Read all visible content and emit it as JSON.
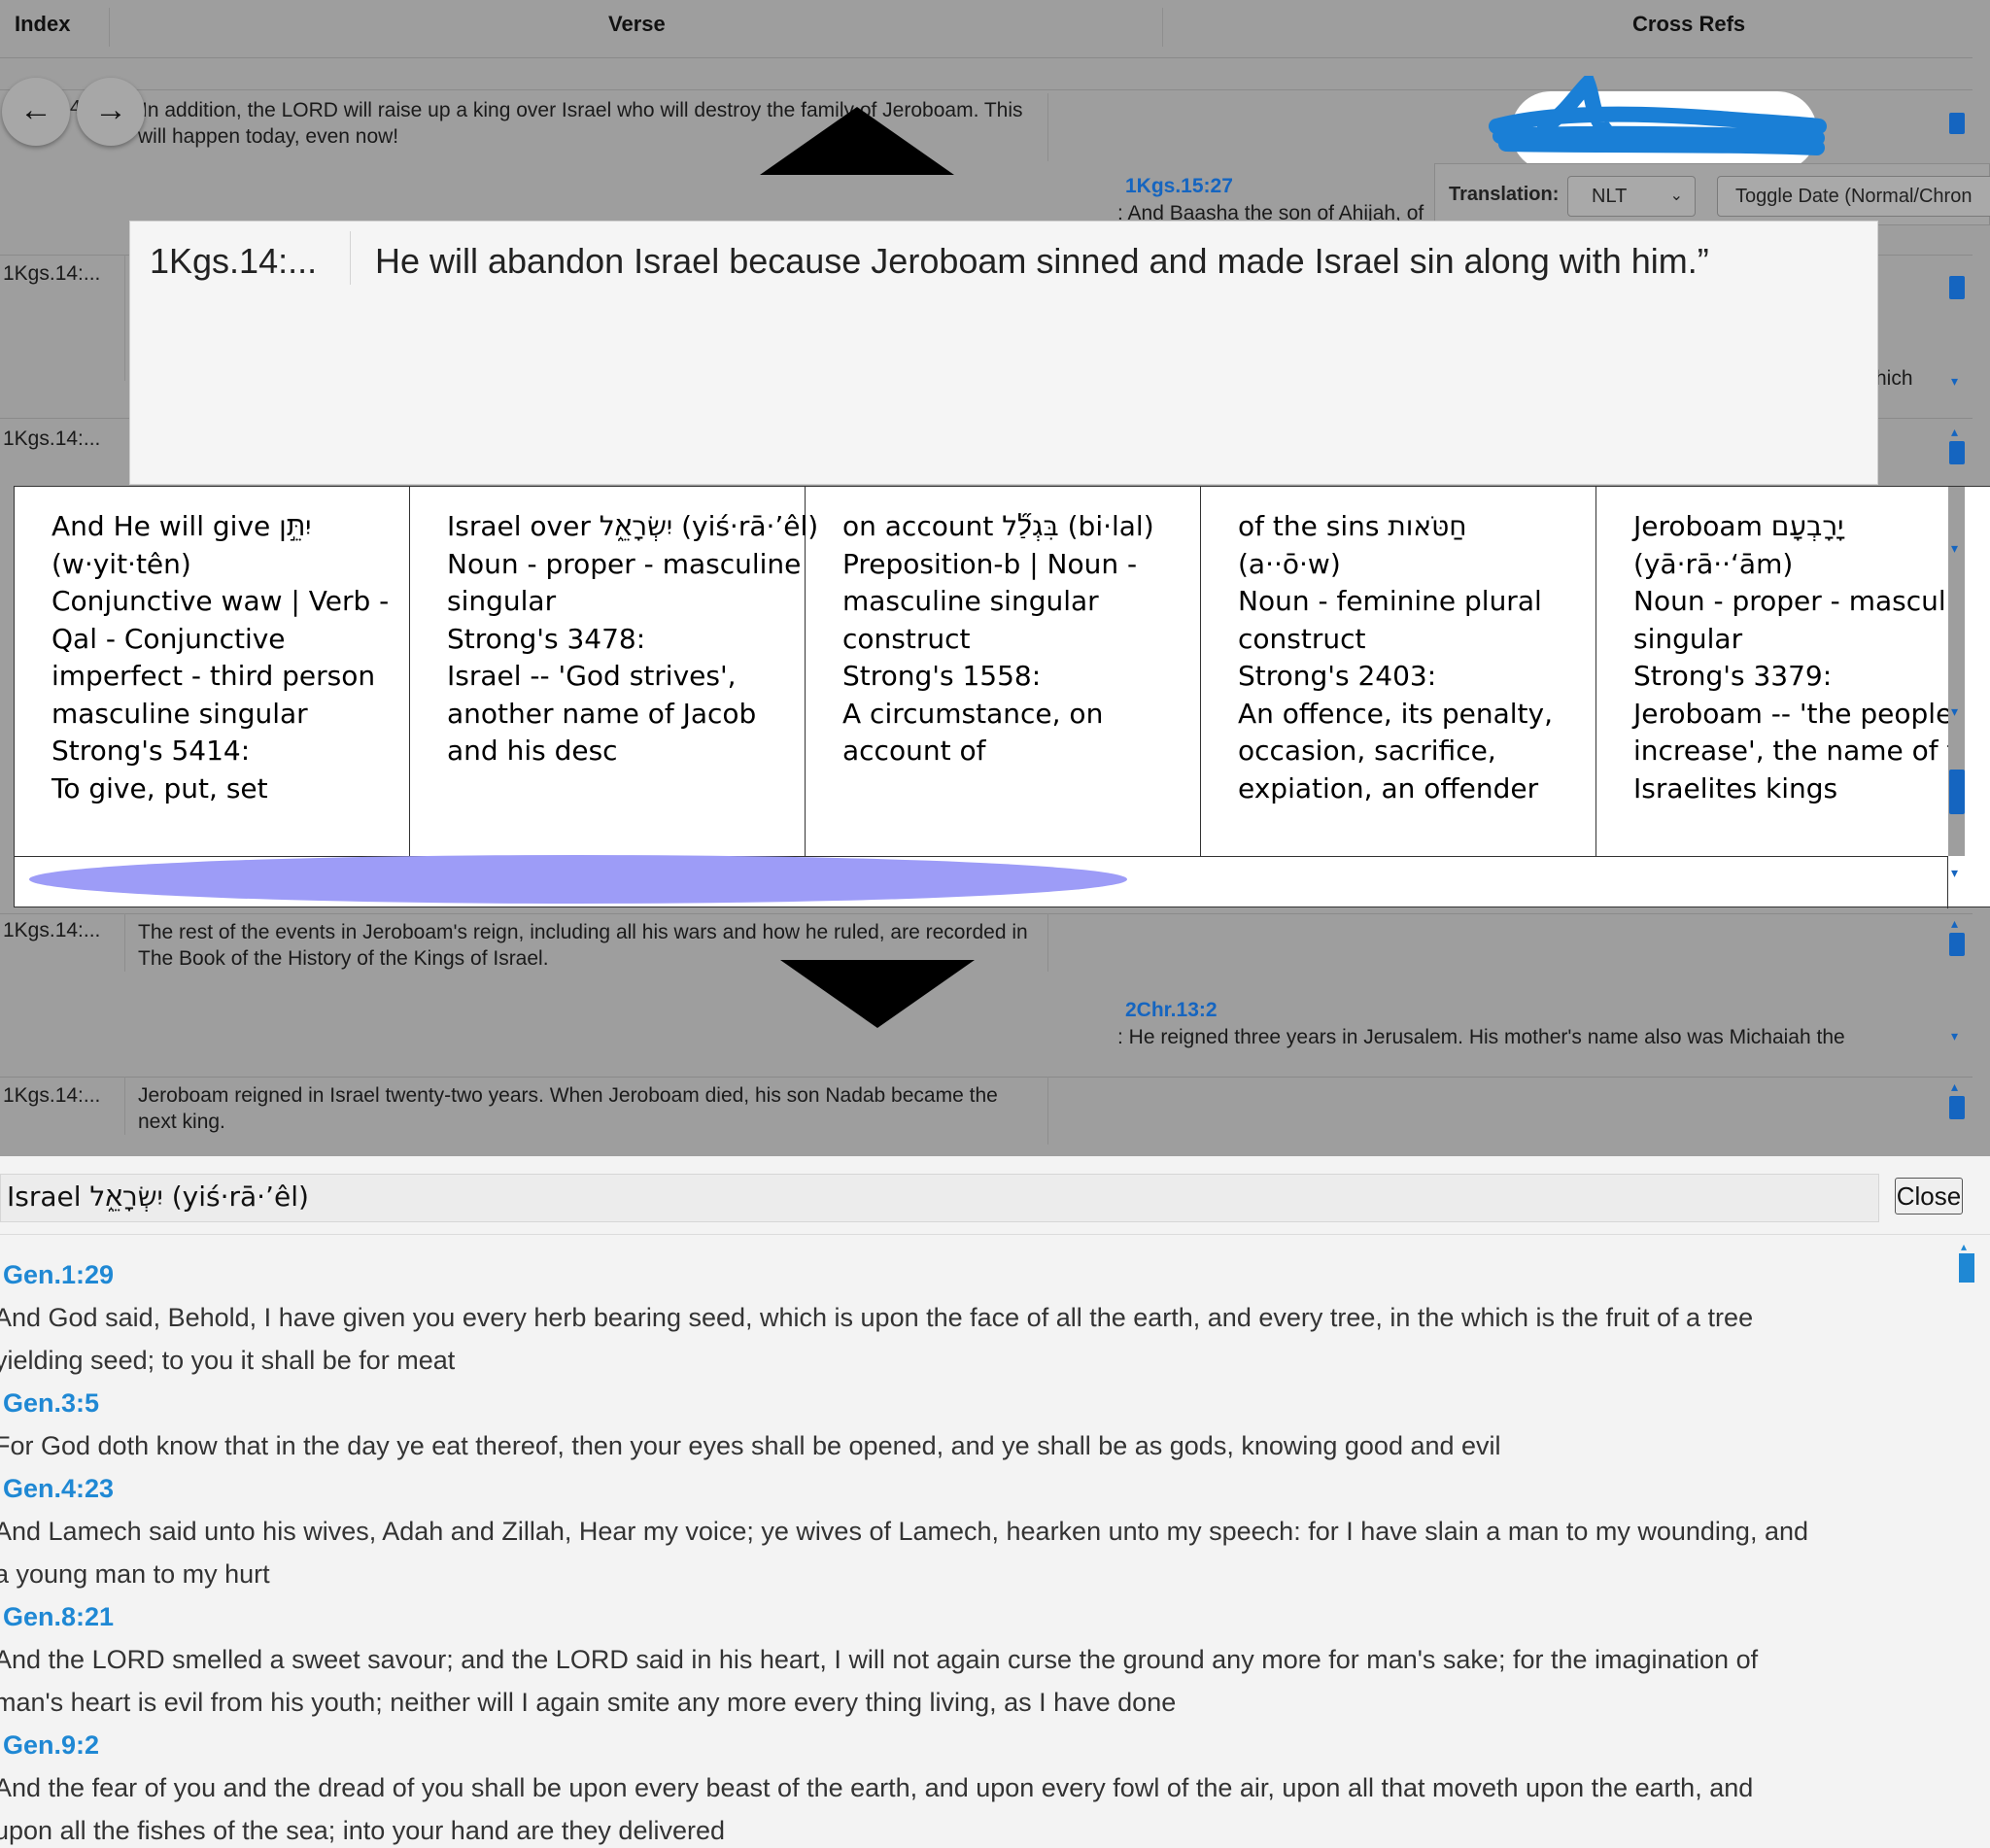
{
  "header": {
    "index": "Index",
    "verse": "Verse",
    "cross_refs": "Cross Refs"
  },
  "nav": {
    "back": "←",
    "forward": "→",
    "stray": "4"
  },
  "rows": [
    {
      "index": "",
      "verse": "'In addition, the LORD will raise up a king over Israel who will destroy the family of Jeroboam. This will happen today, even now!",
      "xref": "1Kgs.15:27",
      "xref_text": ": And Baasha the son of Ahijah, of"
    },
    {
      "index": "1Kgs.14:...",
      "verse": "",
      "xref": "",
      "xref_text": "hich"
    },
    {
      "index": "1Kgs.14:...",
      "verse": "",
      "xref": "",
      "xref_text": ""
    },
    {
      "index": "1Kgs.14:...",
      "verse": "The rest of the events in Jeroboam's reign, including all his wars and how he ruled, are recorded in The Book of the History of the Kings of Israel.",
      "xref": "2Chr.13:2",
      "xref_text": ": He reigned three years in Jerusalem. His mother's name also was Michaiah the"
    },
    {
      "index": "1Kgs.14:...",
      "verse": "Jeroboam reigned in Israel twenty-two years. When Jeroboam died, his son Nadab became the next king.",
      "xref": "",
      "xref_text": ""
    }
  ],
  "toolbar": {
    "translation_label": "Translation:",
    "translation_value": "NLT",
    "toggle_date": "Toggle Date (Normal/Chron"
  },
  "popup": {
    "index": "1Kgs.14:...",
    "verse": "He will abandon Israel because Jeroboam sinned and made Israel sin along with him.”"
  },
  "words": [
    {
      "lines": [
        "And He will give יִתֵּ֣ן",
        "(w·yit·tên)",
        "Conjunctive waw | Verb -",
        "Qal - Conjunctive",
        "imperfect - third person",
        "masculine singular",
        "Strong's 5414:",
        "To give, put, set"
      ]
    },
    {
      "lines": [
        "Israel over יִשְׂרָאֵ֑ל (yiś·rā·’êl)",
        " Noun - proper - masculine",
        "singular",
        " Strong's 3478:",
        "Israel -- 'God strives',",
        "another name of Jacob",
        "and his desc"
      ]
    },
    {
      "lines": [
        "on account בִּגְלַ֞ל (bi·lal)",
        "Preposition-b | Noun -",
        "masculine singular",
        "construct",
        "Strong's 1558:",
        "A circumstance, on",
        "account of"
      ]
    },
    {
      "lines": [
        "of the sins חַטֹּאות",
        "(a··ō·w)",
        "Noun - feminine plural",
        "construct",
        "Strong's 2403:",
        "An offence, its penalty,",
        "occasion, sacrifice,",
        "expiation, an offender"
      ]
    },
    {
      "lines": [
        "Jeroboam יָרָבְעָם",
        "(yā·rā··‘ām)",
        "Noun - proper - masculine",
        "singular",
        "Strong's 3379:",
        "Jeroboam -- 'the people",
        "increase', the name of two",
        "Israelites kings"
      ]
    }
  ],
  "bottom": {
    "word": "Israel יִשְׂרָאֵ֑ל (yiś·rā·’êl)",
    "close_label": "Close",
    "refs": [
      {
        "ref": "Gen.1:29",
        "text": "And God said, Behold, I have given you every herb bearing seed, which is upon the face of all the earth, and every tree, in the which is the fruit of a tree",
        "text2": "yielding seed; to you it shall be for meat"
      },
      {
        "ref": "Gen.3:5",
        "text": "For God doth know that in the day ye eat thereof, then your eyes shall be opened, and ye shall be as gods, knowing good and evil",
        "text2": ""
      },
      {
        "ref": "Gen.4:23",
        "text": "And Lamech said unto his wives, Adah and Zillah, Hear my voice; ye wives of Lamech, hearken unto my speech: for I have slain a man to my wounding, and",
        "text2": "a young man to my hurt"
      },
      {
        "ref": "Gen.8:21",
        "text": "And the LORD smelled a sweet savour; and the LORD said in his heart, I will not again curse the ground any more for man's sake; for the imagination of",
        "text2": "man's heart is evil from his youth; neither will I again smite any more every thing living, as I have done"
      },
      {
        "ref": "Gen.9:2",
        "text": "And the fear of you and the dread of you shall be upon every beast of the earth, and upon every fowl of the air, upon all that moveth upon the earth, and",
        "text2": "upon all the fishes of the sea; into your hand are they delivered"
      }
    ]
  },
  "colors": {
    "link": "#1f88d4",
    "scrollbar": "#1565c0",
    "redaction_blue": "#1a7fd6",
    "redaction_ellipse": "#9d9cf7"
  }
}
